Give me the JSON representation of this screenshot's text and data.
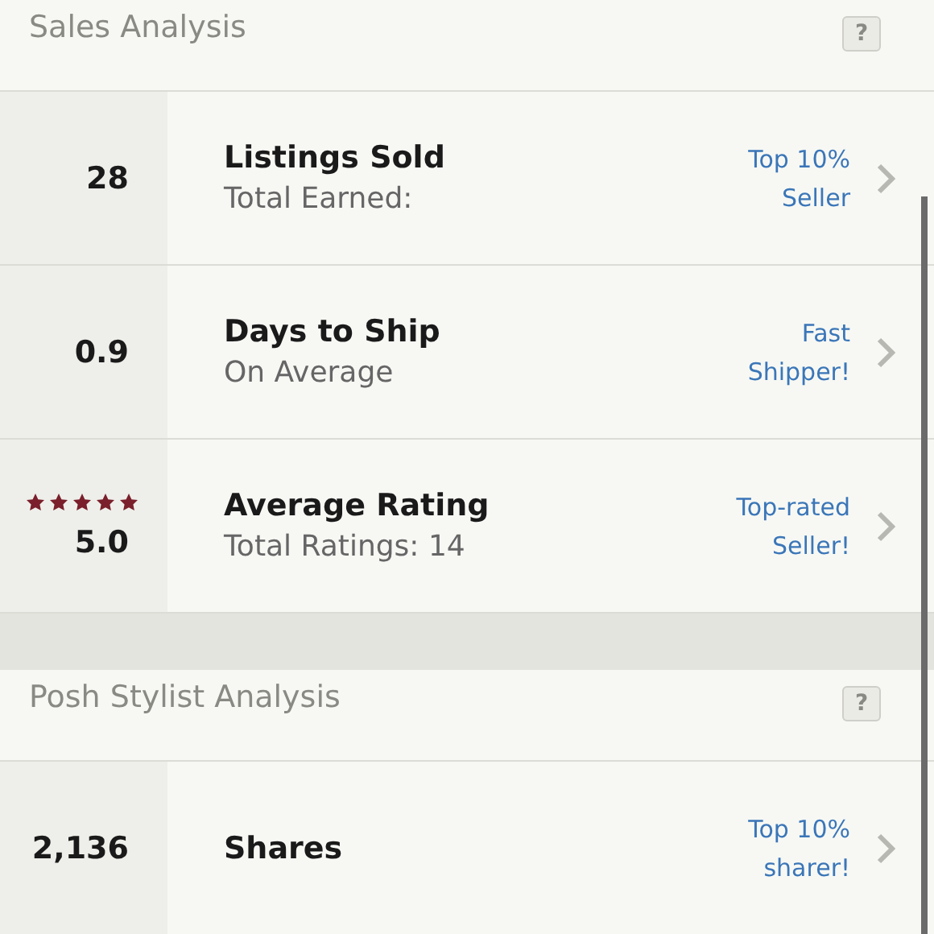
{
  "sections": [
    {
      "title": "Sales Analysis",
      "help": "?",
      "rows": [
        {
          "value": "28",
          "title": "Listings Sold",
          "subtitle": "Total Earned:",
          "badge": "Top 10% Seller"
        },
        {
          "value": "0.9",
          "title": "Days to Ship",
          "subtitle": "On Average",
          "badge": "Fast Shipper!"
        },
        {
          "value": "5.0",
          "stars": 5,
          "title": "Average Rating",
          "subtitle": "Total Ratings: 14",
          "badge": "Top-rated Seller!"
        }
      ]
    },
    {
      "title": "Posh Stylist Analysis",
      "help": "?",
      "rows": [
        {
          "value": "2,136",
          "title": "Shares",
          "badge": "Top 10% sharer!"
        }
      ]
    }
  ]
}
